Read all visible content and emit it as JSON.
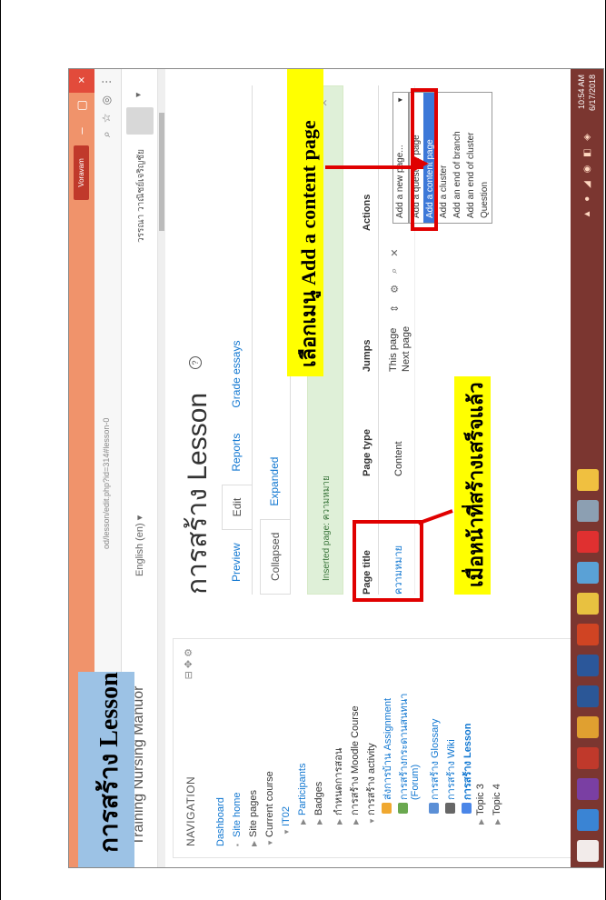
{
  "browser": {
    "profile": "Voravam",
    "url": "od/lesson/edit.php?id=314#lesson-0",
    "window_controls": [
      "–",
      "▢",
      "×"
    ]
  },
  "moodle": {
    "site_name": "Training Nursing Manuor",
    "language": "English (en) ▾",
    "user_name": "วรรณา วาณิชย์เจริญชัย"
  },
  "navigation": {
    "title": "NAVIGATION",
    "items": [
      {
        "label": "Dashboard",
        "bullet": ""
      },
      {
        "label": "Site home",
        "bullet": "▪"
      },
      {
        "label": "Site pages",
        "bullet": "▶"
      },
      {
        "label": "Current course",
        "bullet": "▼"
      },
      {
        "label": "IT02",
        "bullet": "▼"
      },
      {
        "label": "Participants",
        "bullet": "▶"
      },
      {
        "label": "Badges",
        "bullet": "▶"
      },
      {
        "label": "กำหนดการสอน",
        "bullet": "▶"
      },
      {
        "label": "การสร้าง Moodle Course",
        "bullet": "▶"
      },
      {
        "label": "การสร้าง activity",
        "bullet": "▼"
      },
      {
        "label": "ส่งการบ้าน Assignment",
        "bullet": ""
      },
      {
        "label": "การสร้างกระดานสนทนา",
        "bullet": ""
      },
      {
        "label": "(Forum)",
        "bullet": ""
      },
      {
        "label": "การสร้าง Glossary",
        "bullet": ""
      },
      {
        "label": "การสร้าง Wiki",
        "bullet": ""
      },
      {
        "label": "การสร้าง Lesson",
        "bullet": ""
      },
      {
        "label": "Topic 3",
        "bullet": "▶"
      },
      {
        "label": "Topic 4",
        "bullet": "▶"
      }
    ]
  },
  "main": {
    "title": "การสร้าง Lesson",
    "tabs": [
      "Preview",
      "Edit",
      "Reports",
      "Grade essays"
    ],
    "subtabs": [
      "Collapsed",
      "Expanded"
    ],
    "alert": "Inserted page: ความหมาย",
    "alert_close": "×",
    "table": {
      "headers": [
        "Page title",
        "Page type",
        "Jumps",
        "Actions"
      ],
      "row": {
        "title": "ความหมาย",
        "type": "Content",
        "jumps": [
          "This page",
          "Next page"
        ]
      }
    },
    "dropdown": {
      "selected": "Add a new page...",
      "options": [
        "Add a question page",
        "Add a content page",
        "Add a cluster",
        "Add an end of branch",
        "Add an end of cluster",
        "Question"
      ]
    }
  },
  "taskbar": {
    "time": "10:54 AM",
    "date": "6/17/2018"
  },
  "annotations": {
    "heading": "การสร้าง Lesson",
    "note_select": "เลือกเมนู Add a content page",
    "note_done": "เมื่อหน้าที่สร้างเสร็จแล้ว"
  },
  "colors": {
    "annotation_red": "#e00000",
    "label_yellow": "#ffff00",
    "label_blue": "#9cc2e5",
    "moodle_link": "#1177d1"
  }
}
